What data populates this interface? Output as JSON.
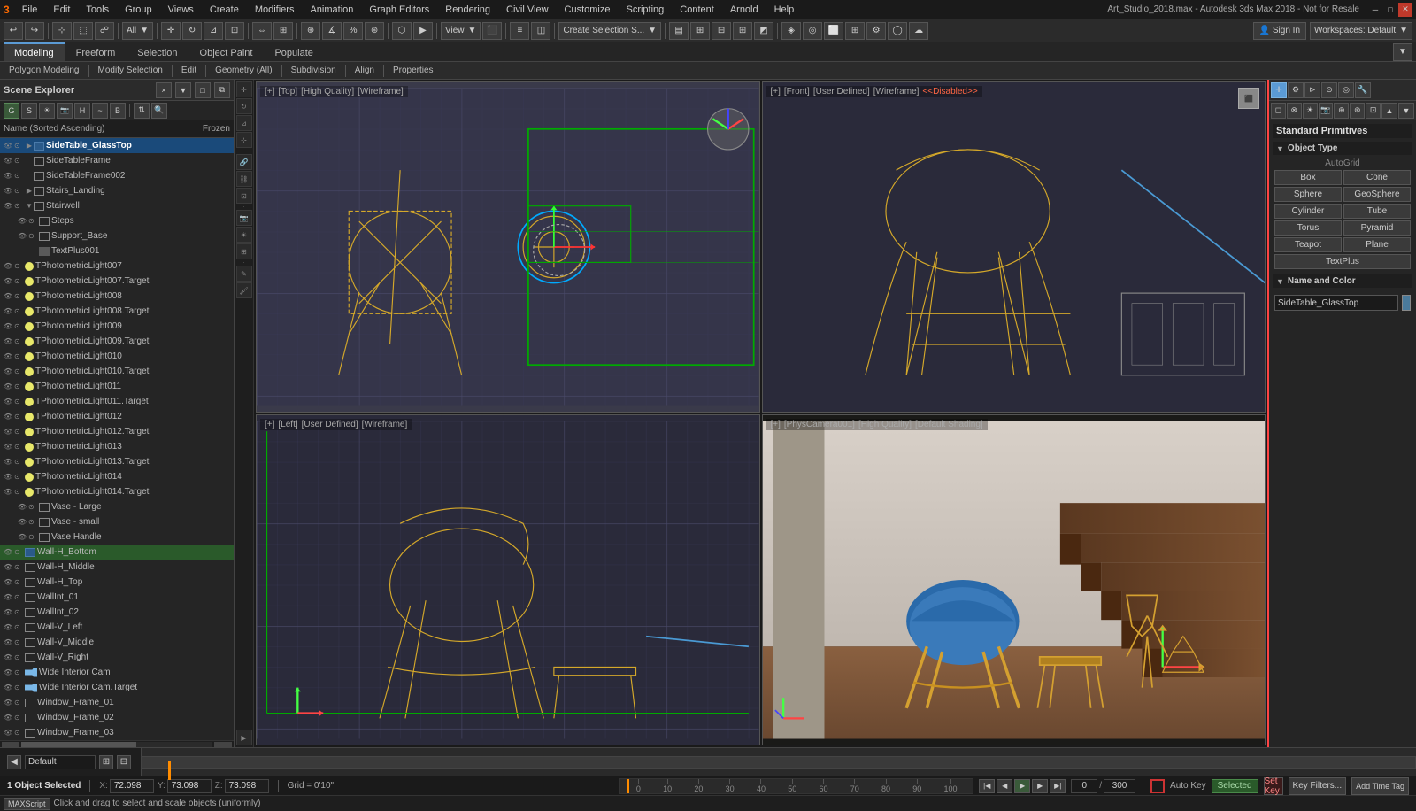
{
  "window": {
    "title": "Art_Studio_2018.max - Autodesk 3ds Max 2018 - Not for Resale"
  },
  "menu": {
    "items": [
      "File",
      "Edit",
      "Tools",
      "Group",
      "Views",
      "Create",
      "Modifiers",
      "Animation",
      "Graph Editors",
      "Rendering",
      "Civil View",
      "Customize",
      "Scripting",
      "Content",
      "Arnold",
      "Help"
    ]
  },
  "toolbar": {
    "mode_dropdown": "All",
    "view_btn": "View",
    "create_selection": "Create Selection S...",
    "workspace_label": "Workspaces: Default",
    "sign_in": "Sign In"
  },
  "tabs": {
    "items": [
      "Modeling",
      "Freeform",
      "Selection",
      "Object Paint",
      "Populate"
    ]
  },
  "ribbon": {
    "items": [
      "Polygon Modeling",
      "Modify Selection",
      "Edit",
      "Geometry (All)",
      "Subdivision",
      "Align",
      "Properties"
    ]
  },
  "explorer": {
    "header_btns": [
      "×",
      "▼",
      "□",
      "⧉"
    ],
    "sort_label": "Name (Sorted Ascending)",
    "frozen_label": "Frozen",
    "objects": [
      {
        "name": "SideTable_GlassTop",
        "level": 0,
        "type": "geo",
        "visible": true,
        "selected": true
      },
      {
        "name": "SideTableFrame",
        "level": 0,
        "type": "geo",
        "visible": true
      },
      {
        "name": "SideTableFrame002",
        "level": 0,
        "type": "geo",
        "visible": true
      },
      {
        "name": "Stairs_Landing",
        "level": 0,
        "type": "geo",
        "visible": true
      },
      {
        "name": "Stairwell",
        "level": 0,
        "type": "geo",
        "visible": true
      },
      {
        "name": "Steps",
        "level": 1,
        "type": "geo",
        "visible": true
      },
      {
        "name": "Support_Base",
        "level": 1,
        "type": "geo",
        "visible": true
      },
      {
        "name": "TextPlus001",
        "level": 1,
        "type": "mesh"
      },
      {
        "name": "TPhotometricLight007",
        "level": 0,
        "type": "light"
      },
      {
        "name": "TPhotometricLight007.Target",
        "level": 0,
        "type": "light"
      },
      {
        "name": "TPhotometricLight008",
        "level": 0,
        "type": "light"
      },
      {
        "name": "TPhotometricLight008.Target",
        "level": 0,
        "type": "light"
      },
      {
        "name": "TPhotometricLight009",
        "level": 0,
        "type": "light"
      },
      {
        "name": "TPhotometricLight009.Target",
        "level": 0,
        "type": "light"
      },
      {
        "name": "TPhotometricLight010",
        "level": 0,
        "type": "light"
      },
      {
        "name": "TPhotometricLight010.Target",
        "level": 0,
        "type": "light"
      },
      {
        "name": "TPhotometricLight011",
        "level": 0,
        "type": "light"
      },
      {
        "name": "TPhotometricLight011.Target",
        "level": 0,
        "type": "light"
      },
      {
        "name": "TPhotometricLight012",
        "level": 0,
        "type": "light"
      },
      {
        "name": "TPhotometricLight012.Target",
        "level": 0,
        "type": "light"
      },
      {
        "name": "TPhotometricLight013",
        "level": 0,
        "type": "light"
      },
      {
        "name": "TPhotometricLight013.Target",
        "level": 0,
        "type": "light"
      },
      {
        "name": "TPhotometricLight014",
        "level": 0,
        "type": "light"
      },
      {
        "name": "TPhotometricLight014.Target",
        "level": 0,
        "type": "light"
      },
      {
        "name": "Vase - Large",
        "level": 1,
        "type": "geo"
      },
      {
        "name": "Vase - small",
        "level": 1,
        "type": "geo"
      },
      {
        "name": "Vase Handle",
        "level": 1,
        "type": "geo"
      },
      {
        "name": "Wall-H_Bottom",
        "level": 0,
        "type": "geo",
        "selected": true
      },
      {
        "name": "Wall-H_Middle",
        "level": 0,
        "type": "geo"
      },
      {
        "name": "Wall-H_Top",
        "level": 0,
        "type": "geo"
      },
      {
        "name": "WallInt_01",
        "level": 0,
        "type": "geo"
      },
      {
        "name": "WallInt_02",
        "level": 0,
        "type": "geo"
      },
      {
        "name": "Wall-V_Left",
        "level": 0,
        "type": "geo"
      },
      {
        "name": "Wall-V_Middle",
        "level": 0,
        "type": "geo"
      },
      {
        "name": "Wall-V_Right",
        "level": 0,
        "type": "geo"
      },
      {
        "name": "Wide Interior Cam",
        "level": 0,
        "type": "camera"
      },
      {
        "name": "Wide Interior Cam.Target",
        "level": 0,
        "type": "camera"
      },
      {
        "name": "Window_Frame_01",
        "level": 0,
        "type": "geo"
      },
      {
        "name": "Window_Frame_02",
        "level": 0,
        "type": "geo"
      },
      {
        "name": "Window_Frame_03",
        "level": 0,
        "type": "geo"
      }
    ]
  },
  "viewports": {
    "top_left": {
      "label": "[+] [Top] [High Quality] [Wireframe]",
      "type": "wireframe"
    },
    "top_right": {
      "label": "[+] [Front] [User Defined] [Wireframe]  <<Disabled>>",
      "type": "wireframe"
    },
    "bottom_left": {
      "label": "[+] [Left] [User Defined] [Wireframe]",
      "type": "wireframe"
    },
    "bottom_right": {
      "label": "[+] [PhysCamera001] [High Quality] [Default Shading]",
      "type": "shaded"
    }
  },
  "right_panel": {
    "title": "Standard Primitives",
    "object_type_header": "Object Type",
    "autogrid_label": "AutoGrid",
    "primitives": [
      "Box",
      "Cone",
      "Sphere",
      "GeoSphere",
      "Cylinder",
      "Tube",
      "Torus",
      "Pyramid",
      "Teapot",
      "Plane",
      "TextPlus"
    ],
    "name_color_header": "Name and Color",
    "selected_name": "SideTable_GlassTop",
    "color": "#4a7a9b"
  },
  "timeline": {
    "frame_start": "0",
    "frame_end": "300",
    "current_frame": "0",
    "frame_label": "0 / 300",
    "ruler_ticks": [
      0,
      10,
      20,
      30,
      40,
      50,
      60,
      70,
      80,
      90
    ]
  },
  "status": {
    "selected_count": "1 Object Selected",
    "help_text": "Click and drag to select and scale objects (uniformly)",
    "x_label": "X:",
    "y_label": "Y:",
    "z_label": "Z:",
    "x_val": "72.098",
    "y_val": "73.098",
    "z_val": "73.098",
    "grid_label": "Grid = 0'10\"",
    "add_time_tag": "Add Time Tag",
    "auto_key": "Auto Key",
    "selected_text": "Selected",
    "set_key": "Set Key",
    "key_filters": "Key Filters..."
  },
  "maxscript": {
    "label": "MAXScript",
    "input_placeholder": "▶"
  },
  "track": {
    "default_label": "Default"
  }
}
